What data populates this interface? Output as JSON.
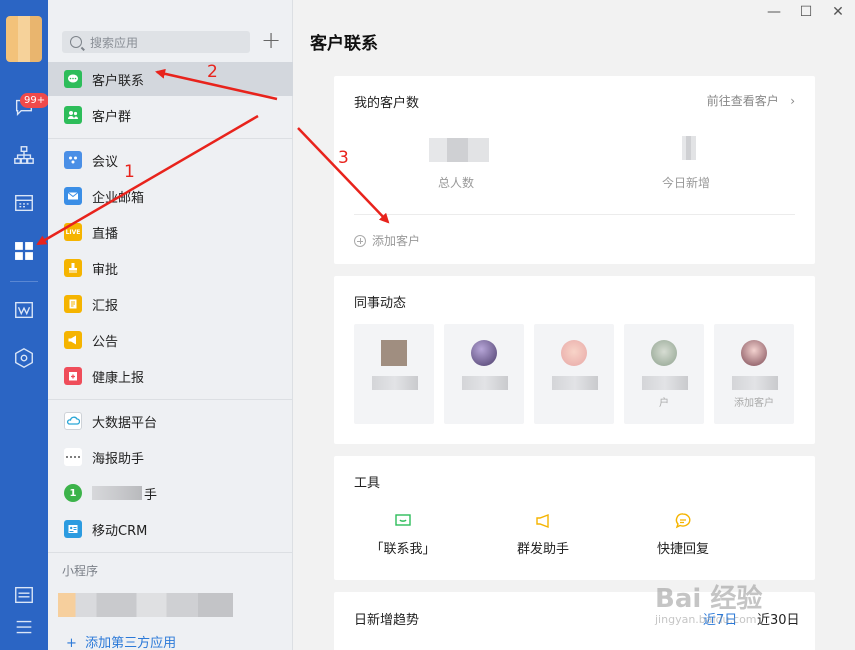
{
  "rail": {
    "badge": "99+"
  },
  "applist": {
    "search_placeholder": "搜索应用",
    "items": [
      {
        "label": "客户联系",
        "icon": "chat-bubble-icon",
        "color": "#2dbd5a"
      },
      {
        "label": "客户群",
        "icon": "group-icon",
        "color": "#2dbd5a"
      },
      {
        "label": "会议",
        "icon": "meeting-icon",
        "color": "#4a8fe6"
      },
      {
        "label": "企业邮箱",
        "icon": "mail-icon",
        "color": "#3a8ee6"
      },
      {
        "label": "直播",
        "icon": "live-icon",
        "color": "#f5b400"
      },
      {
        "label": "审批",
        "icon": "stamp-icon",
        "color": "#f5b400"
      },
      {
        "label": "汇报",
        "icon": "report-icon",
        "color": "#f5b400"
      },
      {
        "label": "公告",
        "icon": "megaphone-icon",
        "color": "#f5b400"
      },
      {
        "label": "健康上报",
        "icon": "health-icon",
        "color": "#ef4d5a"
      },
      {
        "label": "大数据平台",
        "icon": "cloud-icon",
        "color": "#2aa6d6"
      },
      {
        "label": "海报助手",
        "icon": "poster-icon",
        "color": "#555555"
      },
      {
        "label": "手",
        "icon": "app-icon",
        "color": "#3cb34a"
      },
      {
        "label": "移动CRM",
        "icon": "crm-icon",
        "color": "#2b9be0"
      }
    ],
    "live_icon_text": "LIVE",
    "mini_program_title": "小程序",
    "add_third_party": "添加第三方应用"
  },
  "main": {
    "page_title": "客户联系",
    "customers": {
      "title": "我的客户数",
      "view_link": "前往查看客户",
      "total_label": "总人数",
      "today_label": "今日新增",
      "add_customer": "添加客户"
    },
    "colleagues": {
      "title": "同事动态",
      "cards": [
        {
          "sub": ""
        },
        {
          "sub": ""
        },
        {
          "sub": ""
        },
        {
          "sub": "户"
        },
        {
          "sub": "添加客户"
        }
      ]
    },
    "tools": {
      "title": "工具",
      "items": [
        {
          "label": "「联系我」",
          "color": "#2dbd5a"
        },
        {
          "label": "群发助手",
          "color": "#f5b400"
        },
        {
          "label": "快捷回复",
          "color": "#f5b400"
        }
      ]
    },
    "trend": {
      "title": "日新增趋势",
      "tab_7": "近7日",
      "tab_30": "近30日",
      "active_color": "#2b79d8"
    }
  },
  "annotations": {
    "n1": "1",
    "n2": "2",
    "n3": "3",
    "color": "#e8231c"
  },
  "watermark": {
    "main": "Bai 经验",
    "sub": "jingyan.baidu.com"
  }
}
